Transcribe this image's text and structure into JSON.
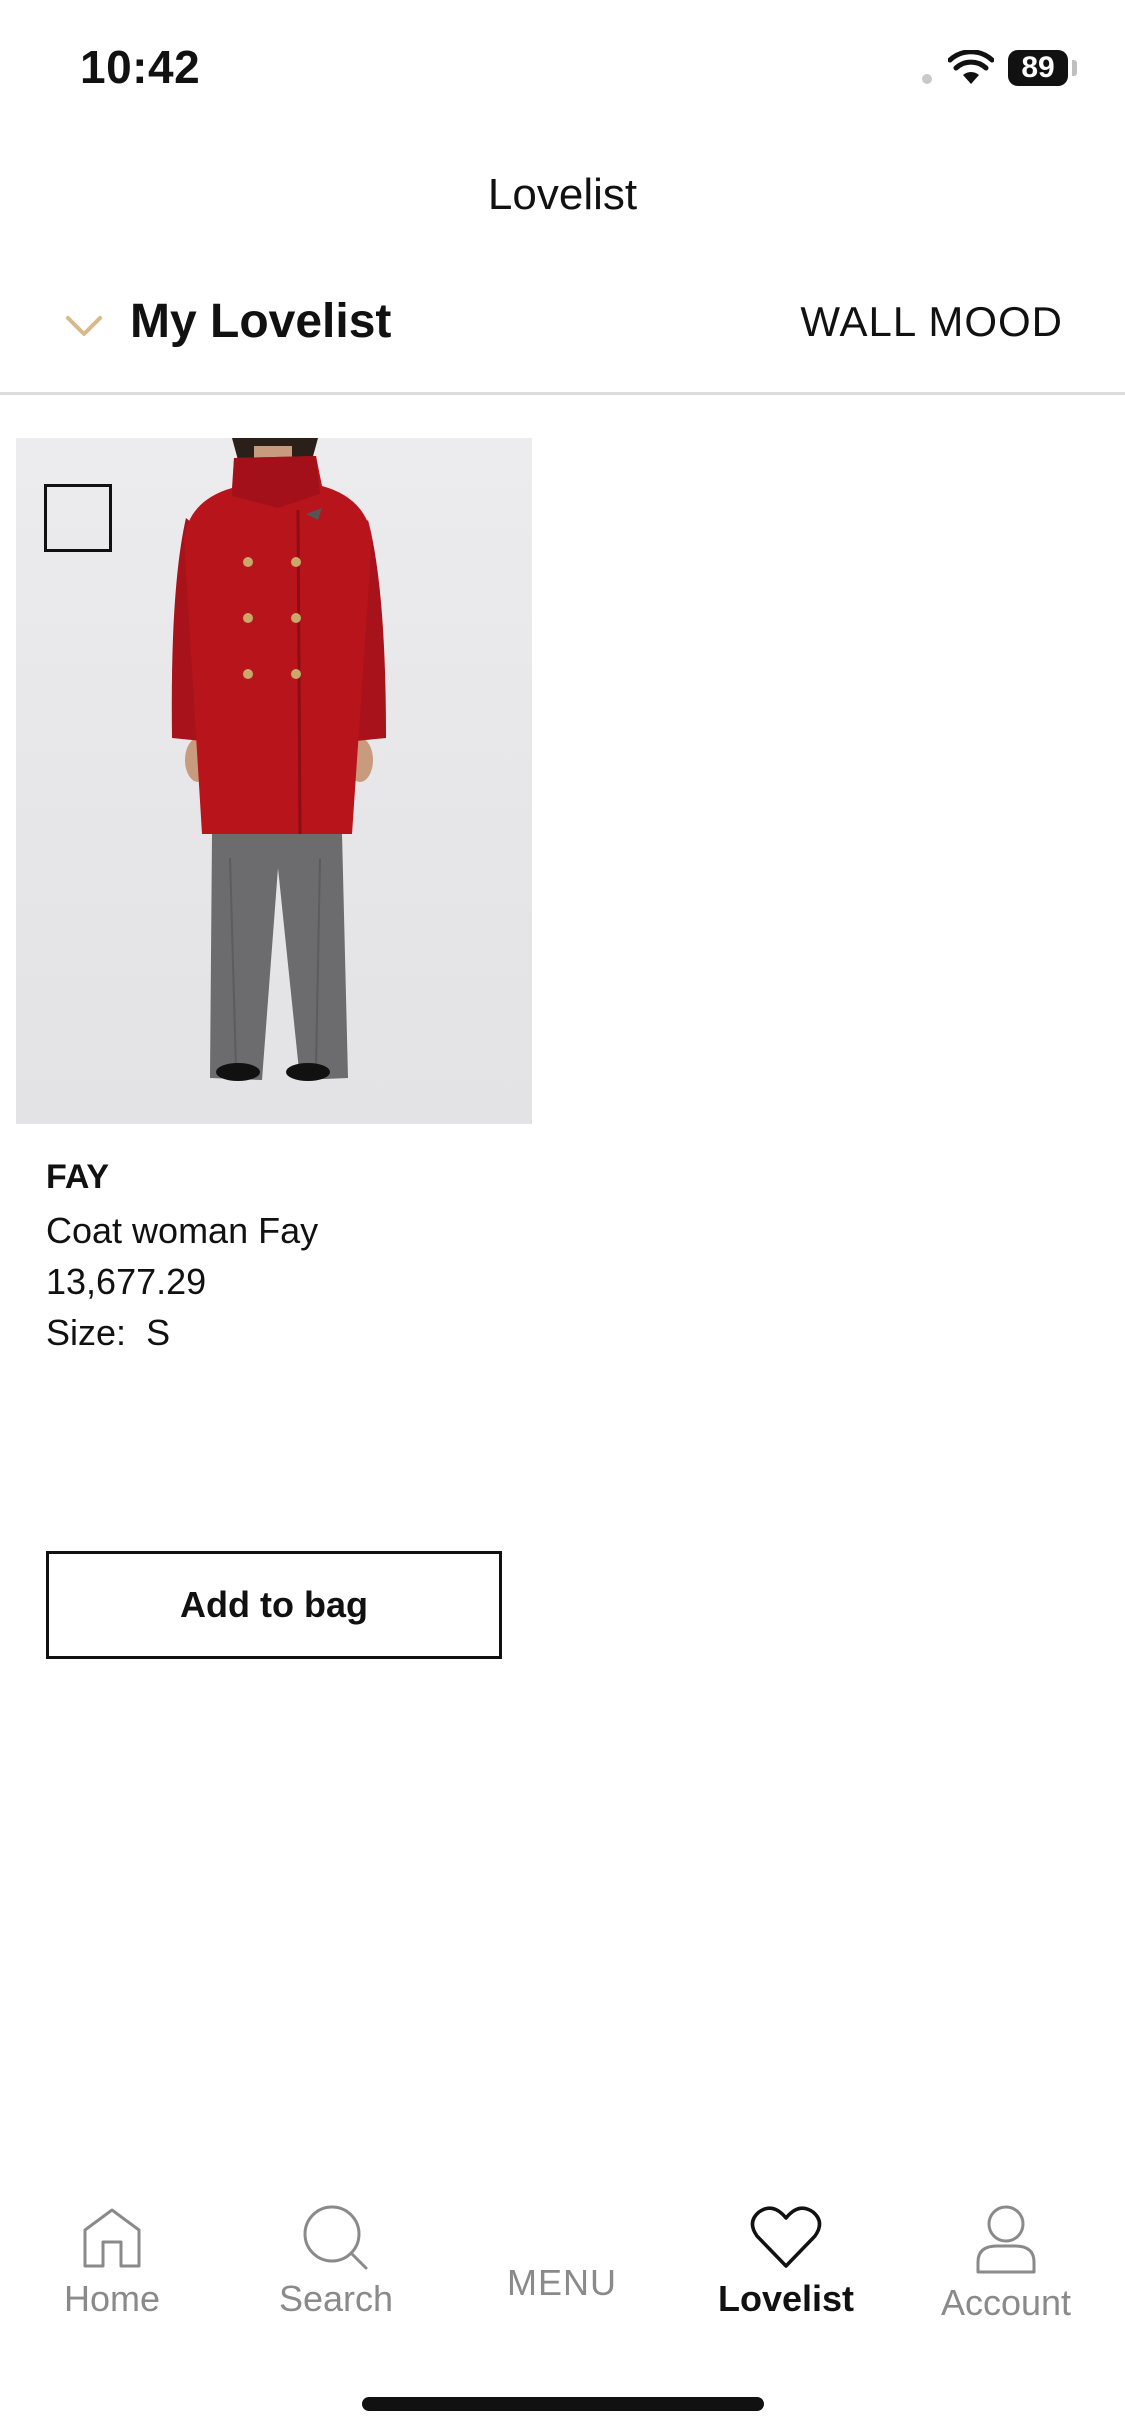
{
  "status_bar": {
    "time": "10:42",
    "battery": "89"
  },
  "header": {
    "title": "Lovelist"
  },
  "list_selector": {
    "name": "My Lovelist",
    "view_toggle": "WALL MOOD"
  },
  "product": {
    "brand": "FAY",
    "name": "Coat woman Fay",
    "price": "13,677.29",
    "size_label": "Size:",
    "size_value": "S",
    "add_to_bag": "Add to bag"
  },
  "tab_bar": {
    "home": "Home",
    "search": "Search",
    "menu": "MENU",
    "lovelist": "Lovelist",
    "account": "Account"
  },
  "colors": {
    "accent_chevron": "#d8b98a",
    "coat_red": "#b8141c",
    "inactive_tab": "#8a8a8a"
  }
}
